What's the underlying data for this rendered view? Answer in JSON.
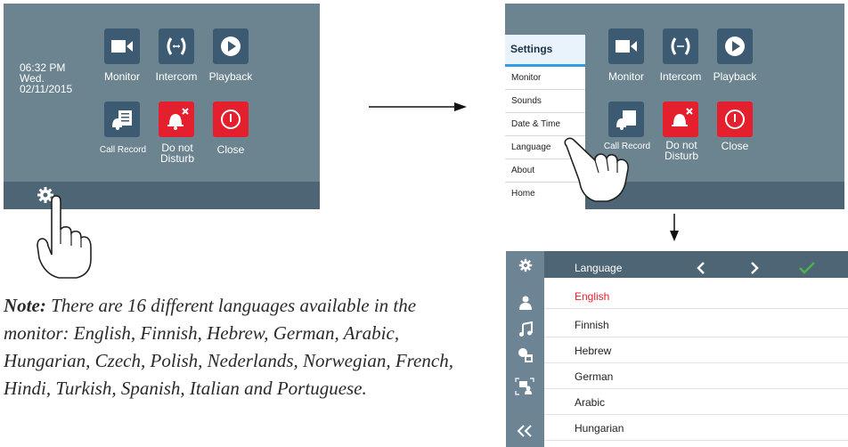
{
  "screen1": {
    "time": "06:32 PM",
    "day": "Wed.",
    "date": "02/11/2015",
    "tiles": [
      {
        "label": "Monitor",
        "icon": "monitor-camera-icon"
      },
      {
        "label": "Intercom",
        "icon": "intercom-icon"
      },
      {
        "label": "Playback",
        "icon": "playback-icon"
      },
      {
        "label": "Call Record",
        "icon": "call-record-icon"
      },
      {
        "label": "Do not Disturb",
        "icon": "do-not-disturb-icon"
      },
      {
        "label": "Close",
        "icon": "close-power-icon"
      }
    ]
  },
  "screen2": {
    "menu_title": "Settings",
    "menu_items": [
      "Monitor",
      "Sounds",
      "Date & Time",
      "Language",
      "About",
      "Home"
    ],
    "tiles": [
      {
        "label": "Monitor"
      },
      {
        "label": "Intercom"
      },
      {
        "label": "Playback"
      },
      {
        "label": "Call Record"
      },
      {
        "label": "Do not Disturb"
      },
      {
        "label": "Close"
      }
    ]
  },
  "language_screen": {
    "title": "Language",
    "languages": [
      "English",
      "Finnish",
      "Hebrew",
      "German",
      "Arabic",
      "Hungarian"
    ],
    "selected_color": "#e5202e"
  },
  "note": {
    "label": "Note:",
    "text": "There are 16 different languages available in the monitor: English, Finnish, Hebrew, German, Arabic, Hungarian, Czech, Polish, Nederlands, Norwegian, French, Hindi, Turkish, Spanish, Italian and Portuguese."
  },
  "colors": {
    "screen_bg": "#6c8390",
    "bar_bg": "#4e6576",
    "tile_blue": "#3c5a71",
    "tile_red": "#e5202e",
    "accent_blue": "#2f9de0",
    "check_green": "#4caf50"
  }
}
